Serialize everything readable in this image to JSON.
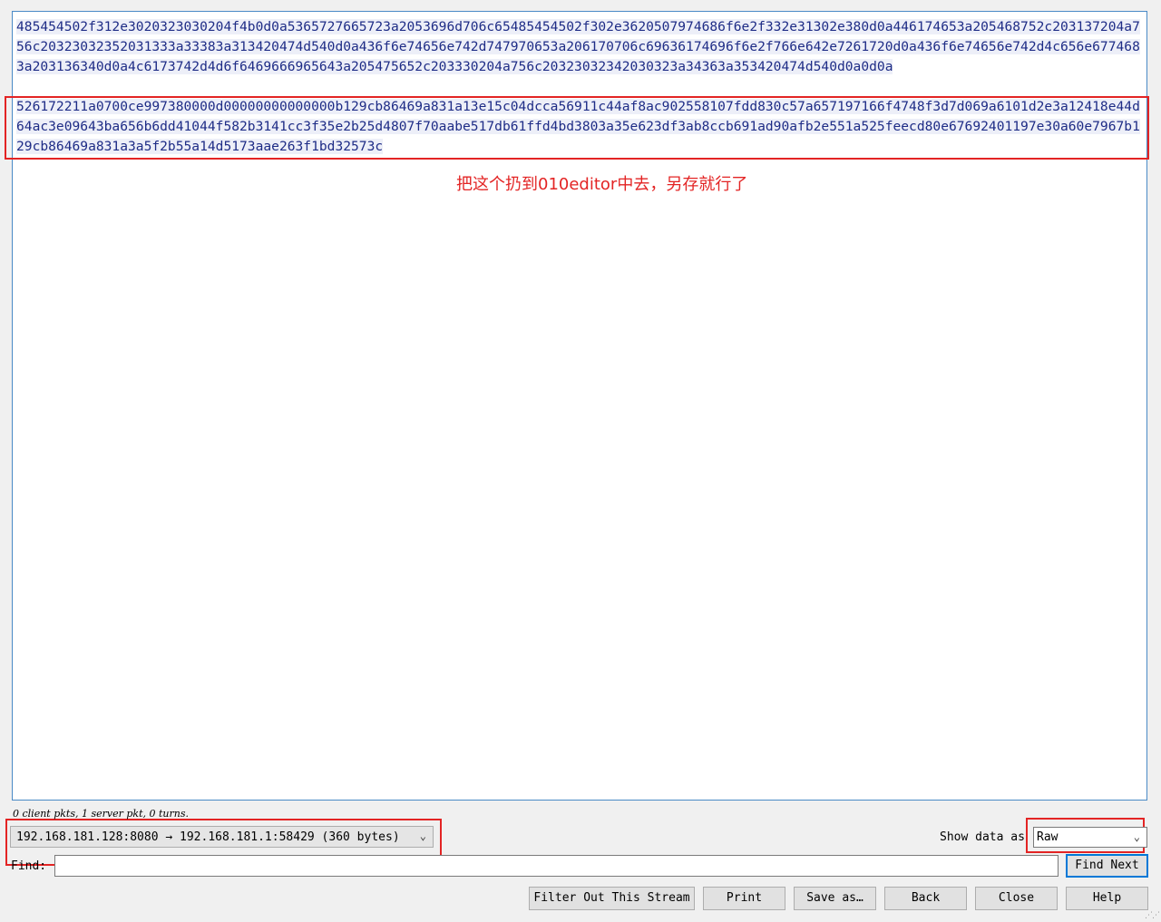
{
  "stream": {
    "client_hex": "485454502f312e3020323030204f4b0d0a5365727665723a2053696d706c65485454502f302e3620507974686f6e2f332e31302e380d0a446174653a205468752c203137204a756c20323032352031333a33383a313420474d540d0a436f6e74656e742d747970653a206170706c69636174696f6e2f766e642e7261720d0a436f6e74656e742d4c656e6774683a203136340d0a4c6173742d4d6f6469666965643a205475652c203330204a756c20323032342030323a34363a353420474d540d0a0d0a",
    "server_hex": "526172211a0700ce997380000d00000000000000b129cb86469a831a13e15c04dcca56911c44af8ac902558107fdd830c57a657197166f4748f3d7d069a6101d2e3a12418e44d64ac3e09643ba656b6dd41044f582b3141cc3f35e2b25d4807f70aabe517db61ffd4bd3803a35e623df3ab8ccb691ad90afb2e551a525feecd80e67692401197e30a60e7967b129cb86469a831a3a5f2b55a14d5173aae263f1bd32573c"
  },
  "annotation": {
    "note": "把这个扔到010editor中去，另存就行了",
    "color": "#e32424"
  },
  "stats": "0 client pkts, 1 server pkt, 0 turns.",
  "controls": {
    "stream_selector": "192.168.181.128:8080 → 192.168.181.1:58429 (360 bytes)",
    "show_data_label": "Show data as",
    "format_value": "Raw",
    "find_label": "Find:",
    "find_value": "",
    "find_next": "Find Next"
  },
  "buttons": {
    "filter_out": "Filter Out This Stream",
    "print": "Print",
    "save_as": "Save as…",
    "back": "Back",
    "close": "Close",
    "help": "Help"
  }
}
